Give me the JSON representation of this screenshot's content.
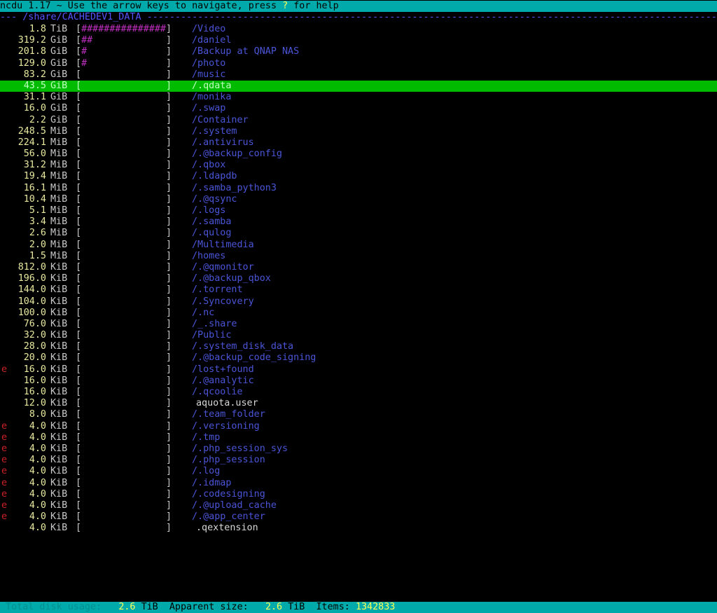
{
  "header": {
    "prefix": "ncdu 1.17 ~ Use the arrow keys to navigate, press ",
    "key": "?",
    "suffix": " for help"
  },
  "path": {
    "lead": "--- ",
    "dir": "/share/CACHEDEV1_DATA",
    "tail": " -----------------------------------------------------------------------------------------------------------------------------------------"
  },
  "entries": [
    {
      "flag": "",
      "size": "1.8",
      "unit": "TiB",
      "fill": "###############",
      "name": "/Video",
      "type": "dir"
    },
    {
      "flag": "",
      "size": "319.2",
      "unit": "GiB",
      "fill": "##",
      "name": "/daniel",
      "type": "dir"
    },
    {
      "flag": "",
      "size": "201.8",
      "unit": "GiB",
      "fill": "#",
      "name": "/Backup at QNAP NAS",
      "type": "dir"
    },
    {
      "flag": "",
      "size": "129.0",
      "unit": "GiB",
      "fill": "#",
      "name": "/photo",
      "type": "dir"
    },
    {
      "flag": "",
      "size": "83.2",
      "unit": "GiB",
      "fill": "",
      "name": "/music",
      "type": "dir"
    },
    {
      "flag": "",
      "size": "43.5",
      "unit": "GiB",
      "fill": "",
      "name": "/.qdata",
      "type": "dir",
      "selected": true
    },
    {
      "flag": "",
      "size": "31.1",
      "unit": "GiB",
      "fill": "",
      "name": "/monika",
      "type": "dir"
    },
    {
      "flag": "",
      "size": "16.0",
      "unit": "GiB",
      "fill": "",
      "name": "/.swap",
      "type": "dir"
    },
    {
      "flag": "",
      "size": "2.2",
      "unit": "GiB",
      "fill": "",
      "name": "/Container",
      "type": "dir"
    },
    {
      "flag": "",
      "size": "248.5",
      "unit": "MiB",
      "fill": "",
      "name": "/.system",
      "type": "dir"
    },
    {
      "flag": "",
      "size": "224.1",
      "unit": "MiB",
      "fill": "",
      "name": "/.antivirus",
      "type": "dir"
    },
    {
      "flag": "",
      "size": "56.0",
      "unit": "MiB",
      "fill": "",
      "name": "/.@backup_config",
      "type": "dir"
    },
    {
      "flag": "",
      "size": "31.2",
      "unit": "MiB",
      "fill": "",
      "name": "/.qbox",
      "type": "dir"
    },
    {
      "flag": "",
      "size": "19.4",
      "unit": "MiB",
      "fill": "",
      "name": "/.ldapdb",
      "type": "dir"
    },
    {
      "flag": "",
      "size": "16.1",
      "unit": "MiB",
      "fill": "",
      "name": "/.samba_python3",
      "type": "dir"
    },
    {
      "flag": "",
      "size": "10.4",
      "unit": "MiB",
      "fill": "",
      "name": "/.@qsync",
      "type": "dir"
    },
    {
      "flag": "",
      "size": "5.1",
      "unit": "MiB",
      "fill": "",
      "name": "/.logs",
      "type": "dir"
    },
    {
      "flag": "",
      "size": "3.4",
      "unit": "MiB",
      "fill": "",
      "name": "/.samba",
      "type": "dir"
    },
    {
      "flag": "",
      "size": "2.6",
      "unit": "MiB",
      "fill": "",
      "name": "/.qulog",
      "type": "dir"
    },
    {
      "flag": "",
      "size": "2.0",
      "unit": "MiB",
      "fill": "",
      "name": "/Multimedia",
      "type": "dir"
    },
    {
      "flag": "",
      "size": "1.5",
      "unit": "MiB",
      "fill": "",
      "name": "/homes",
      "type": "dir"
    },
    {
      "flag": "",
      "size": "812.0",
      "unit": "KiB",
      "fill": "",
      "name": "/.@qmonitor",
      "type": "dir"
    },
    {
      "flag": "",
      "size": "196.0",
      "unit": "KiB",
      "fill": "",
      "name": "/.@backup_qbox",
      "type": "dir"
    },
    {
      "flag": "",
      "size": "144.0",
      "unit": "KiB",
      "fill": "",
      "name": "/.torrent",
      "type": "dir"
    },
    {
      "flag": "",
      "size": "104.0",
      "unit": "KiB",
      "fill": "",
      "name": "/.Syncovery",
      "type": "dir"
    },
    {
      "flag": "",
      "size": "100.0",
      "unit": "KiB",
      "fill": "",
      "name": "/.nc",
      "type": "dir"
    },
    {
      "flag": "",
      "size": "76.0",
      "unit": "KiB",
      "fill": "",
      "name": "/_.share",
      "type": "dir"
    },
    {
      "flag": "",
      "size": "32.0",
      "unit": "KiB",
      "fill": "",
      "name": "/Public",
      "type": "dir"
    },
    {
      "flag": "",
      "size": "28.0",
      "unit": "KiB",
      "fill": "",
      "name": "/.system_disk_data",
      "type": "dir"
    },
    {
      "flag": "",
      "size": "20.0",
      "unit": "KiB",
      "fill": "",
      "name": "/.@backup_code_signing",
      "type": "dir"
    },
    {
      "flag": "e",
      "size": "16.0",
      "unit": "KiB",
      "fill": "",
      "name": "/lost+found",
      "type": "dir"
    },
    {
      "flag": "",
      "size": "16.0",
      "unit": "KiB",
      "fill": "",
      "name": "/.@analytic",
      "type": "dir"
    },
    {
      "flag": "",
      "size": "16.0",
      "unit": "KiB",
      "fill": "",
      "name": "/.qcoolie",
      "type": "dir"
    },
    {
      "flag": "",
      "size": "12.0",
      "unit": "KiB",
      "fill": "",
      "name": "aquota.user",
      "type": "file"
    },
    {
      "flag": "",
      "size": "8.0",
      "unit": "KiB",
      "fill": "",
      "name": "/.team_folder",
      "type": "dir"
    },
    {
      "flag": "e",
      "size": "4.0",
      "unit": "KiB",
      "fill": "",
      "name": "/.versioning",
      "type": "dir"
    },
    {
      "flag": "e",
      "size": "4.0",
      "unit": "KiB",
      "fill": "",
      "name": "/.tmp",
      "type": "dir"
    },
    {
      "flag": "e",
      "size": "4.0",
      "unit": "KiB",
      "fill": "",
      "name": "/.php_session_sys",
      "type": "dir"
    },
    {
      "flag": "e",
      "size": "4.0",
      "unit": "KiB",
      "fill": "",
      "name": "/.php_session",
      "type": "dir"
    },
    {
      "flag": "e",
      "size": "4.0",
      "unit": "KiB",
      "fill": "",
      "name": "/.log",
      "type": "dir"
    },
    {
      "flag": "e",
      "size": "4.0",
      "unit": "KiB",
      "fill": "",
      "name": "/.idmap",
      "type": "dir"
    },
    {
      "flag": "e",
      "size": "4.0",
      "unit": "KiB",
      "fill": "",
      "name": "/.codesigning",
      "type": "dir"
    },
    {
      "flag": "e",
      "size": "4.0",
      "unit": "KiB",
      "fill": "",
      "name": "/.@upload_cache",
      "type": "dir"
    },
    {
      "flag": "e",
      "size": "4.0",
      "unit": "KiB",
      "fill": "",
      "name": "/.@app_center",
      "type": "dir"
    },
    {
      "flag": "",
      "size": "4.0",
      "unit": "KiB",
      "fill": "",
      "name": ".qextension",
      "type": "file"
    }
  ],
  "footer": {
    "total_label": " Total disk usage:",
    "total_value": "2.6",
    "total_unit": "TiB",
    "apparent_label": "Apparent size:",
    "apparent_value": "2.6",
    "apparent_unit": "TiB",
    "items_label": "Items:",
    "items_value": "1342833"
  },
  "colors": {
    "header_bg": "#00aaaa",
    "selected_bg": "#00bb00",
    "dir_name": "#4a55d8",
    "bar_fill": "#c030c0",
    "error_flag": "#cc2222"
  }
}
